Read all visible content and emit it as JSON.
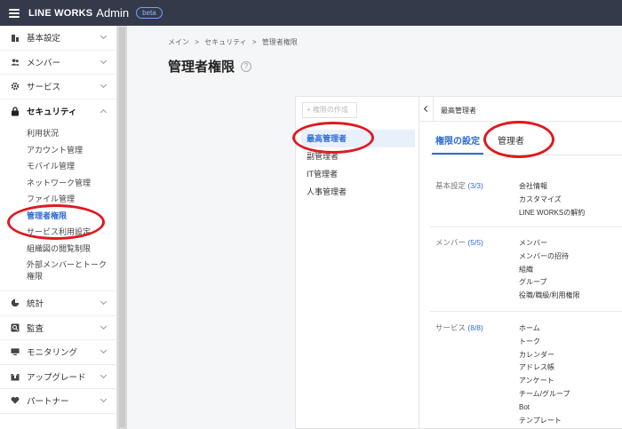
{
  "app": {
    "brand": "LINE WORKS",
    "product": "Admin",
    "badge": "beta"
  },
  "sidebar": {
    "groups": [
      {
        "label": "基本設定",
        "icon": "building-icon",
        "expanded": false
      },
      {
        "label": "メンバー",
        "icon": "users-icon",
        "expanded": false
      },
      {
        "label": "サービス",
        "icon": "gear-icon",
        "expanded": false
      },
      {
        "label": "セキュリティ",
        "icon": "lock-icon",
        "expanded": true
      },
      {
        "label": "統計",
        "icon": "pie-chart-icon",
        "expanded": false
      },
      {
        "label": "監査",
        "icon": "audit-icon",
        "expanded": false
      },
      {
        "label": "モニタリング",
        "icon": "monitor-icon",
        "expanded": false
      },
      {
        "label": "アップグレード",
        "icon": "upgrade-icon",
        "expanded": false
      },
      {
        "label": "パートナー",
        "icon": "heart-icon",
        "expanded": false
      }
    ],
    "security_items": [
      "利用状況",
      "アカウント管理",
      "モバイル管理",
      "ネットワーク管理",
      "ファイル管理",
      "管理者権限",
      "サービス利用設定",
      "組織図の閲覧制限",
      "外部メンバーとトーク権限"
    ],
    "selected_item": "管理者権限"
  },
  "breadcrumb": [
    "メイン",
    ">",
    "セキュリティ",
    ">",
    "管理者権限"
  ],
  "page": {
    "title": "管理者権限",
    "help": "?"
  },
  "admin_panel": {
    "create_button": "+ 権限の作成",
    "items": [
      "最高管理者",
      "副管理者",
      "IT管理者",
      "人事管理者"
    ],
    "selected": "最高管理者"
  },
  "detail_panel": {
    "header": "最高管理者",
    "tabs": [
      "権限の設定",
      "管理者"
    ],
    "active_tab": "権限の設定",
    "sections": [
      {
        "category": "基本設定",
        "count": "(3/3)",
        "items": [
          "会社情報",
          "カスタマイズ",
          "LINE WORKSの解約"
        ]
      },
      {
        "category": "メンバー",
        "count": "(5/5)",
        "items": [
          "メンバー",
          "メンバーの招待",
          "組織",
          "グループ",
          "役職/職級/利用権限"
        ]
      },
      {
        "category": "サービス",
        "count": "(8/8)",
        "items": [
          "ホーム",
          "トーク",
          "カレンダー",
          "アドレス帳",
          "アンケート",
          "チーム/グループ",
          "Bot",
          "テンプレート"
        ]
      }
    ]
  },
  "colors": {
    "topbar": "#353a4b",
    "accent": "#2f6cd6",
    "annotation": "#e0191e"
  }
}
